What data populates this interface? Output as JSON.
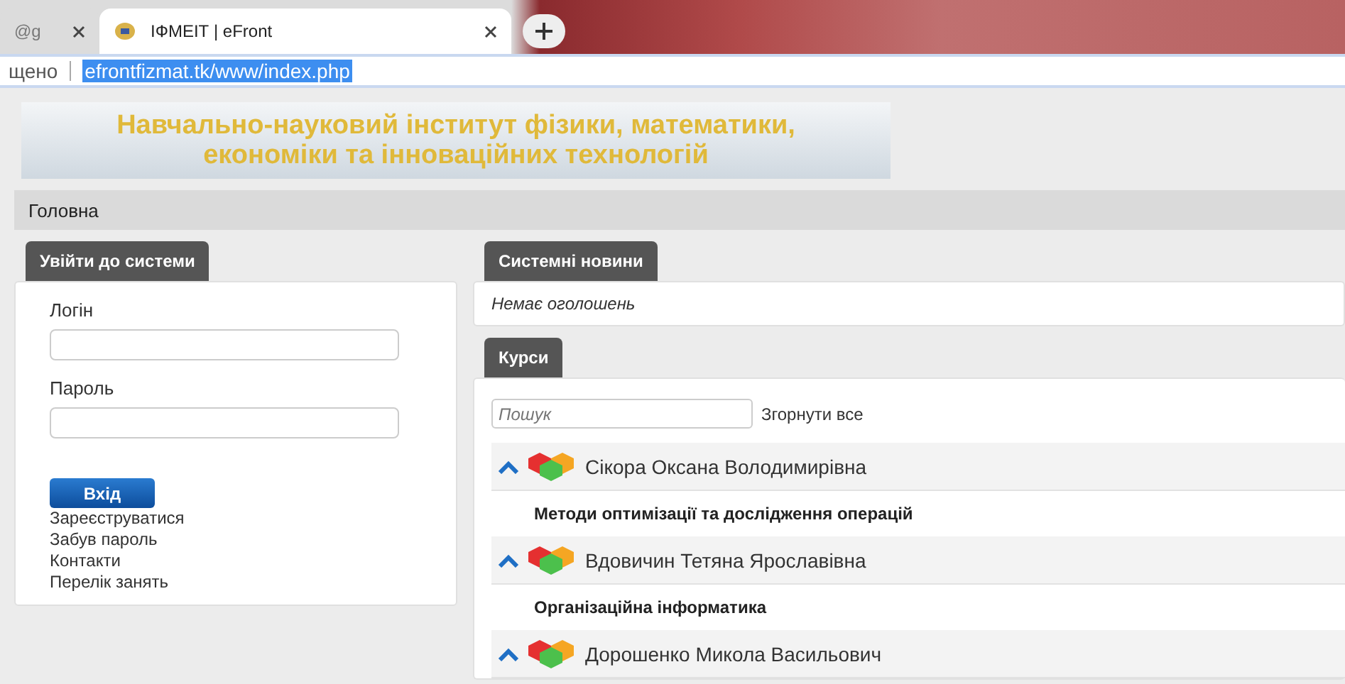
{
  "browser": {
    "tabs": [
      {
        "title": "@g",
        "selected": false
      },
      {
        "title": "ІФМЕІТ | eFront",
        "selected": true
      }
    ],
    "address_prefix": "щено",
    "url": "efrontfizmat.tk/www/index.php"
  },
  "banner": {
    "title": "Навчально-науковий інститут фізики, математики, економіки та інноваційних технологій"
  },
  "nav": {
    "items": [
      "Головна"
    ]
  },
  "login": {
    "title": "Увійти до системи",
    "fields": [
      {
        "label": "Логін"
      },
      {
        "label": "Пароль"
      }
    ],
    "button": "Вхід",
    "links": [
      "Зареєструватися",
      "Забув пароль",
      "Контакти",
      "Перелік занять"
    ]
  },
  "news": {
    "title": "Системні новини",
    "message": "Немає оголошень"
  },
  "courses": {
    "title": "Курси",
    "search": {
      "placeholder": "Пошук"
    },
    "collapse_all": "Згорнути все",
    "groups": [
      {
        "name": "Сікора Оксана Володимирівна",
        "expanded": true,
        "courses": [
          "Методи оптимізації та дослідження операцій"
        ]
      },
      {
        "name": "Вдовичин Тетяна Ярославівна",
        "expanded": true,
        "courses": [
          "Організаційна інформатика"
        ]
      },
      {
        "name": "Дорошенко Микола Васильович",
        "expanded": true
      }
    ]
  }
}
